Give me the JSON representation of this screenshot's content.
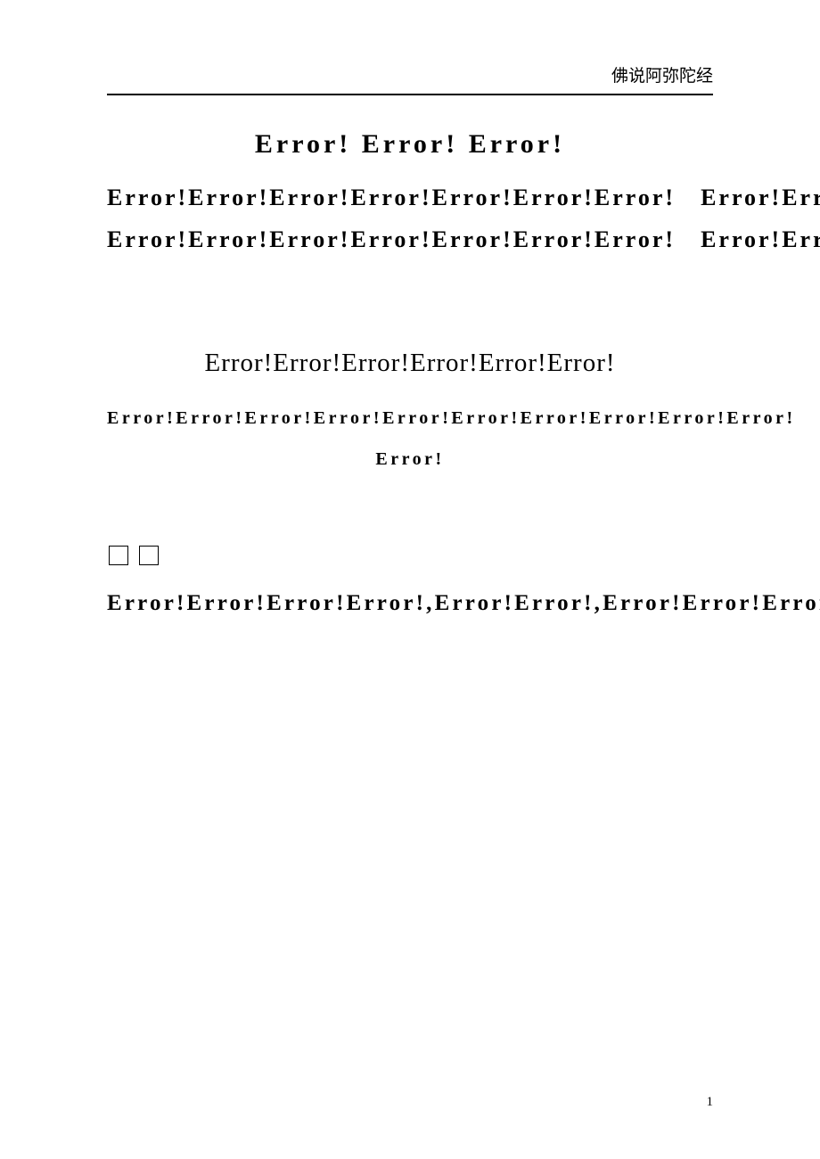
{
  "header": {
    "title": "佛说阿弥陀经"
  },
  "topTitle": "Error! Error! Error!",
  "columns": {
    "left": "Error!Error!Error!Error!Error!Error!Error! Error!Error!Error!Error!Error!Error!Error!",
    "right": "Error!Error!Error!Error!Error!Error!Error! Error!Error!Error!Error!Error!Error!Error!"
  },
  "midTitle": "Error!Error!Error!Error!Error!Error!",
  "midSub": "Error!Error!Error!Error!Error!Error!Error!Error!Error!Error! Error!",
  "body": "Error!Error!Error!Error!,Error!Error!,Error!Error!Error!Error!Error!,Error!Error!Error!Error!",
  "pageNumber": "1"
}
